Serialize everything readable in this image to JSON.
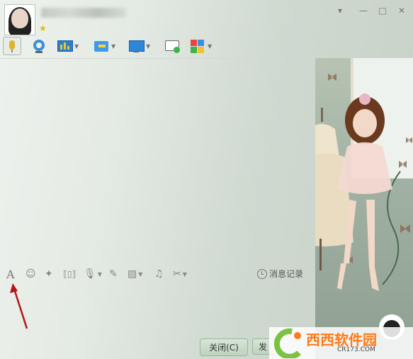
{
  "titlebar": {
    "buttons": {
      "menu": "▾",
      "minimize": "—",
      "maximize": "□",
      "close": "✕"
    }
  },
  "toolbar": {
    "items": [
      "voice-call",
      "video-call",
      "share-screen",
      "send-file",
      "remote-assist",
      "create-discussion",
      "apps"
    ]
  },
  "inputbar": {
    "history_label": "消息记录"
  },
  "buttons": {
    "close_label": "关闭(C)",
    "send_label": "发"
  },
  "watermark": {
    "text": "西西软件园",
    "sub": "CR173.COM"
  },
  "colors": {
    "accent_orange": "#ff7a1a",
    "arrow_red": "#b0161a"
  }
}
